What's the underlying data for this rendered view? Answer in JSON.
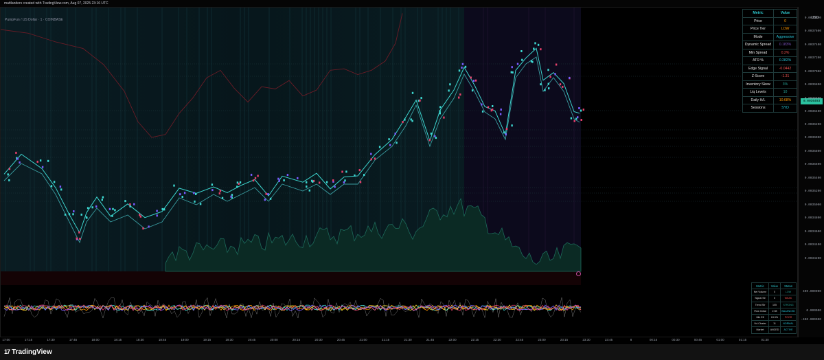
{
  "header": {
    "caption": "mattlanders created with TradingView.com, Aug 07, 2025 23:16 UTC"
  },
  "chart": {
    "symbol_title": "PumpFun / US Dollar · 1 · COINBASE",
    "currency": "USD"
  },
  "price_axis": {
    "labels": [
      "0.0037800",
      "0.0037600",
      "0.0037400",
      "0.0037200",
      "0.0037000",
      "0.0036800",
      "0.0036600",
      "0.0036400",
      "0.0036200",
      "0.0036000",
      "0.0035800",
      "0.0035600",
      "0.0035400",
      "0.0035200",
      "0.0035000",
      "0.0034800",
      "0.0034600",
      "0.0034400",
      "0.0034200",
      "400.000000",
      "0.000000",
      "-400.000000"
    ],
    "current_price": "0.0036493"
  },
  "time_axis": {
    "labels": [
      "17:00",
      "17:15",
      "17:30",
      "17:45",
      "18:00",
      "18:15",
      "18:30",
      "18:45",
      "19:00",
      "19:15",
      "19:30",
      "19:45",
      "20:00",
      "20:15",
      "20:30",
      "20:45",
      "21:00",
      "21:15",
      "21:30",
      "21:45",
      "22:00",
      "22:15",
      "22:30",
      "22:45",
      "23:00",
      "23:15",
      "23:30",
      "23:45",
      "8",
      "00:15",
      "00:30",
      "00:45",
      "01:00",
      "01:15",
      "01:30"
    ]
  },
  "metrics_table": {
    "header": [
      "Metric",
      "Value"
    ],
    "rows": [
      {
        "label": "Price",
        "value": "0",
        "color": "#ff9800"
      },
      {
        "label": "Price Tier",
        "value": "LOW",
        "color": "#ff9800"
      },
      {
        "label": "Mode",
        "value": "Aggressive",
        "color": "#26c6da"
      },
      {
        "label": "Dynamic Spread",
        "value": "0.183%",
        "color": "#7e57c2"
      },
      {
        "label": "Min Spread",
        "value": "0.2%",
        "color": "#ef5350"
      },
      {
        "label": "ATR %",
        "value": "0.282%",
        "color": "#26c6da"
      },
      {
        "label": "Edge Signal",
        "value": "-0.0442",
        "color": "#ef5350"
      },
      {
        "label": "Z-Score",
        "value": "-1.31",
        "color": "#ef5350"
      },
      {
        "label": "Inventory Skew",
        "value": "3%",
        "color": "#26a69a"
      },
      {
        "label": "Liq Levels",
        "value": "10",
        "color": "#26a69a"
      },
      {
        "label": "Daily H/L",
        "value": "10.68%",
        "color": "#ff9800"
      },
      {
        "label": "Sessions",
        "value": "SYD",
        "color": "#26c6da"
      }
    ]
  },
  "status_table": {
    "header": [
      "Metric",
      "Value",
      "Status"
    ],
    "rows": [
      {
        "label": "Net Volume",
        "value": "0",
        "status": "LOW",
        "color": "#26a69a"
      },
      {
        "label": "Signal Str",
        "value": "0",
        "status": "WEAK",
        "color": "#ef5350"
      },
      {
        "label": "Trend Str",
        "value": "105",
        "status": "STRONG",
        "color": "#26a69a"
      },
      {
        "label": "Flow Imbal",
        "value": "2.98",
        "status": "BALANCED",
        "color": "#26c6da"
      },
      {
        "label": "Mkt Eff",
        "value": "24.9%",
        "status": "POOR",
        "color": "#ef5350"
      },
      {
        "label": "Vol Cluster",
        "value": "11",
        "status": "NORMAL",
        "color": "#26c6da"
      },
      {
        "label": "Market",
        "value": "ANCED",
        "status": "ACTIVE",
        "color": "#26c6da"
      }
    ]
  },
  "branding": {
    "name": "TradingView",
    "mark": "17"
  }
}
